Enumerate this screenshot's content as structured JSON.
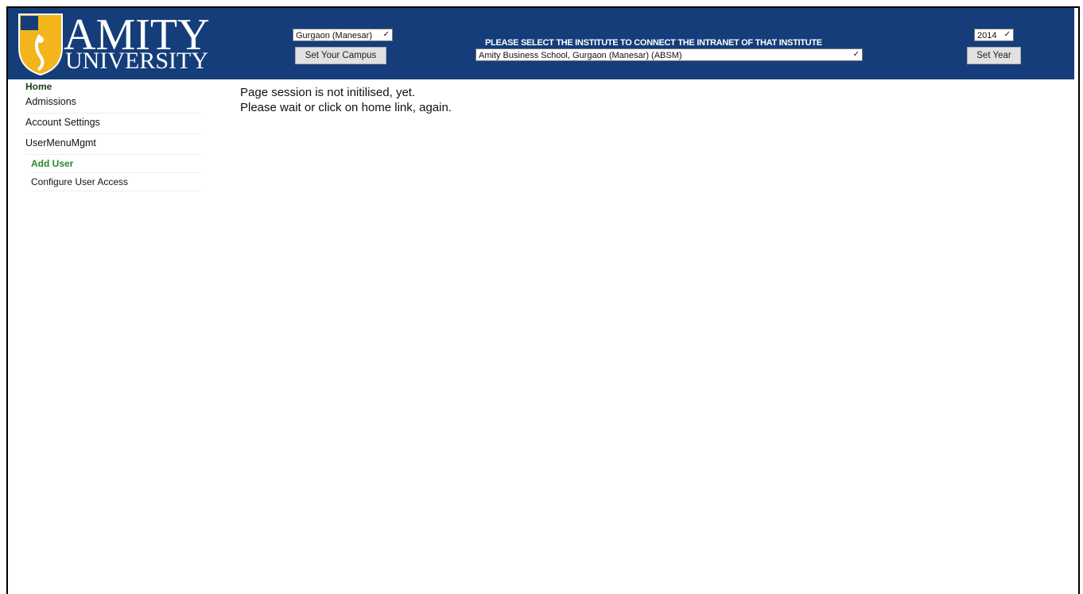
{
  "header": {
    "logo": {
      "line1": "AMITY",
      "line2": "UNIVERSITY",
      "crest_text": "AMITY"
    },
    "campus": {
      "selected": "Gurgaon (Manesar)",
      "button_label": "Set Your Campus"
    },
    "institute": {
      "prompt": "PLEASE SELECT THE INSTITUTE TO CONNECT THE INTRANET OF THAT INSTITUTE",
      "selected": "Amity Business School, Gurgaon (Manesar) (ABSM)"
    },
    "year": {
      "selected": "2014",
      "button_label": "Set Year"
    }
  },
  "sidebar": {
    "home": "Home",
    "items": [
      "Admissions",
      "Account Settings",
      "UserMenuMgmt"
    ],
    "sub_items": [
      {
        "label": "Add User",
        "active": true
      },
      {
        "label": "Configure User Access",
        "active": false
      }
    ]
  },
  "main": {
    "line1": "Page session is not initilised, yet.",
    "line2": "Please wait or click on home link, again."
  },
  "colors": {
    "header_bg": "#153d7a",
    "active_link": "#2a8a2a"
  }
}
